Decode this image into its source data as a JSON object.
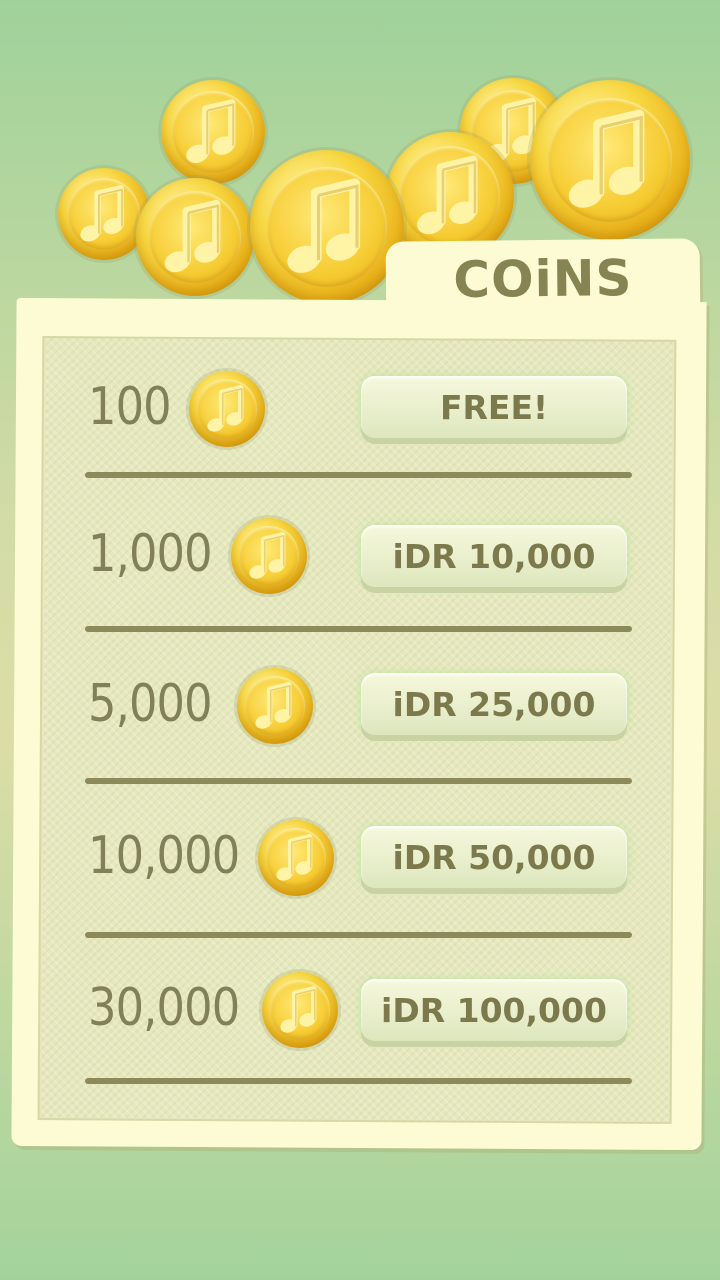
{
  "header": {
    "title": "COiNS"
  },
  "packages": [
    {
      "amount": "100",
      "price_label": "FREE!"
    },
    {
      "amount": "1,000",
      "price_label": "iDR 10,000"
    },
    {
      "amount": "5,000",
      "price_label": "iDR 25,000"
    },
    {
      "amount": "10,000",
      "price_label": "iDR 50,000"
    },
    {
      "amount": "30,000",
      "price_label": "iDR 100,000"
    }
  ],
  "icons": {
    "coin": "music-note-coin-icon"
  },
  "colors": {
    "background_green": "#a3d39b",
    "panel_cream": "#fdfbd3",
    "panel_inner": "#e6e8bd",
    "text_olive": "#828059",
    "divider": "#8c8a5a",
    "coin_gold": "#f2c62c"
  }
}
